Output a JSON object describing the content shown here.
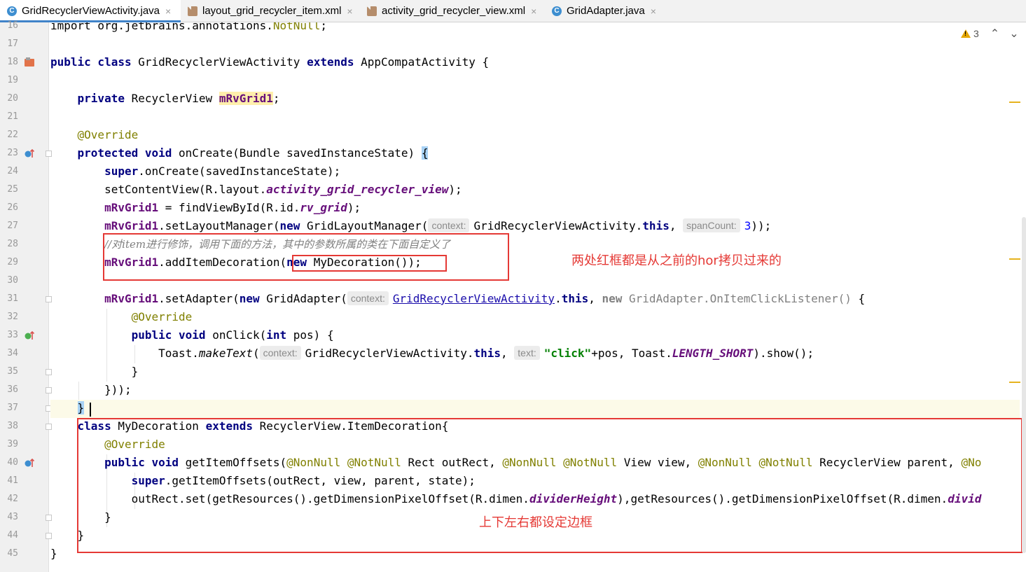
{
  "tabs": [
    {
      "label": "GridRecyclerViewActivity.java",
      "icon": "java-class-icon",
      "active": true
    },
    {
      "label": "layout_grid_recycler_item.xml",
      "icon": "xml-file-icon",
      "active": false
    },
    {
      "label": "activity_grid_recycler_view.xml",
      "icon": "xml-file-icon",
      "active": false
    },
    {
      "label": "GridAdapter.java",
      "icon": "java-class-icon",
      "active": false
    }
  ],
  "tab_close_glyph": "×",
  "java_icon_letter": "C",
  "inspections": {
    "warning_count": "3",
    "up_glyph": "⌃",
    "down_glyph": "⌄"
  },
  "line_numbers": [
    "16",
    "17",
    "18",
    "19",
    "20",
    "21",
    "22",
    "23",
    "24",
    "25",
    "26",
    "27",
    "28",
    "29",
    "30",
    "31",
    "32",
    "33",
    "34",
    "35",
    "36",
    "37",
    "38",
    "39",
    "40",
    "41",
    "42",
    "43",
    "44",
    "45"
  ],
  "lines": [
    [
      [
        "n",
        "import org.jetbrains.annotations."
      ],
      [
        "an",
        "NotNull"
      ],
      [
        "n",
        ";"
      ]
    ],
    [],
    [
      [
        "kw",
        "public class "
      ],
      [
        "n",
        "GridRecyclerViewActivity "
      ],
      [
        "kw",
        "extends "
      ],
      [
        "n",
        "AppCompatActivity {"
      ]
    ],
    [],
    [
      [
        "n",
        "    "
      ],
      [
        "kw",
        "private "
      ],
      [
        "n",
        "RecyclerView "
      ],
      [
        "fdh",
        "mRvGrid1"
      ],
      [
        "n",
        ";"
      ]
    ],
    [],
    [
      [
        "n",
        "    "
      ],
      [
        "an",
        "@Override"
      ]
    ],
    [
      [
        "n",
        "    "
      ],
      [
        "kw",
        "protected void "
      ],
      [
        "n",
        "onCreate(Bundle savedInstanceState) "
      ],
      [
        "br",
        "{"
      ]
    ],
    [
      [
        "n",
        "        "
      ],
      [
        "kw",
        "super"
      ],
      [
        "n",
        ".onCreate(savedInstanceState);"
      ]
    ],
    [
      [
        "n",
        "        setContentView(R.layout."
      ],
      [
        "st",
        "activity_grid_recycler_view"
      ],
      [
        "n",
        ");"
      ]
    ],
    [
      [
        "n",
        "        "
      ],
      [
        "fd",
        "mRvGrid1"
      ],
      [
        "n",
        " = findViewById(R.id."
      ],
      [
        "st",
        "rv_grid"
      ],
      [
        "n",
        ");"
      ]
    ],
    [
      [
        "n",
        "        "
      ],
      [
        "fd",
        "mRvGrid1"
      ],
      [
        "n",
        ".setLayoutManager("
      ],
      [
        "kw",
        "new "
      ],
      [
        "n",
        "GridLayoutManager("
      ],
      [
        "hint",
        "context:"
      ],
      [
        "n",
        "GridRecyclerViewActivity."
      ],
      [
        "kw",
        "this"
      ],
      [
        "n",
        ", "
      ],
      [
        "hint",
        "spanCount:"
      ],
      [
        "num",
        "3"
      ],
      [
        "n",
        "));"
      ]
    ],
    [
      [
        "n",
        "        "
      ],
      [
        "cm",
        "//对item进行修饰，调用下面的方法，其中的参数所属的类在下面自定义了"
      ]
    ],
    [
      [
        "n",
        "        "
      ],
      [
        "fd",
        "mRvGrid1"
      ],
      [
        "n",
        ".addItemDecoration("
      ],
      [
        "kw",
        "new "
      ],
      [
        "n",
        "MyDecoration());"
      ]
    ],
    [],
    [
      [
        "n",
        "        "
      ],
      [
        "fd",
        "mRvGrid1"
      ],
      [
        "n",
        ".setAdapter("
      ],
      [
        "kw",
        "new "
      ],
      [
        "n",
        "GridAdapter("
      ],
      [
        "hint",
        "context:"
      ],
      [
        "lnk",
        "GridRecyclerViewActivity"
      ],
      [
        "n",
        "."
      ],
      [
        "kw",
        "this"
      ],
      [
        "n",
        ", "
      ],
      [
        "kwg",
        "new "
      ],
      [
        "gr",
        "GridAdapter.OnItemClickListener() "
      ],
      [
        "n",
        "{"
      ]
    ],
    [
      [
        "n",
        "            "
      ],
      [
        "an",
        "@Override"
      ]
    ],
    [
      [
        "n",
        "            "
      ],
      [
        "kw",
        "public void "
      ],
      [
        "n",
        "onClick("
      ],
      [
        "kw",
        "int "
      ],
      [
        "n",
        "pos) {"
      ]
    ],
    [
      [
        "n",
        "                Toast."
      ],
      [
        "it",
        "makeText"
      ],
      [
        "n",
        "("
      ],
      [
        "hint",
        "context:"
      ],
      [
        "n",
        "GridRecyclerViewActivity."
      ],
      [
        "kw",
        "this"
      ],
      [
        "n",
        ", "
      ],
      [
        "hint",
        "text:"
      ],
      [
        "str",
        "\"click\""
      ],
      [
        "n",
        "+pos, Toast."
      ],
      [
        "st",
        "LENGTH_SHORT"
      ],
      [
        "n",
        ").show();"
      ]
    ],
    [
      [
        "n",
        "            }"
      ]
    ],
    [
      [
        "n",
        "        }));"
      ]
    ],
    [
      [
        "n",
        "    "
      ],
      [
        "br",
        "}"
      ]
    ],
    [
      [
        "n",
        "    "
      ],
      [
        "kw",
        "class "
      ],
      [
        "n",
        "MyDecoration "
      ],
      [
        "kw",
        "extends "
      ],
      [
        "n",
        "RecyclerView.ItemDecoration{"
      ]
    ],
    [
      [
        "n",
        "        "
      ],
      [
        "an",
        "@Override"
      ]
    ],
    [
      [
        "n",
        "        "
      ],
      [
        "kw",
        "public void "
      ],
      [
        "n",
        "getItemOffsets("
      ],
      [
        "an",
        "@NonNull @NotNull "
      ],
      [
        "n",
        "Rect outRect, "
      ],
      [
        "an",
        "@NonNull @NotNull "
      ],
      [
        "n",
        "View view, "
      ],
      [
        "an",
        "@NonNull @NotNull "
      ],
      [
        "n",
        "RecyclerView parent, "
      ],
      [
        "an",
        "@No"
      ]
    ],
    [
      [
        "n",
        "            "
      ],
      [
        "kw",
        "super"
      ],
      [
        "n",
        ".getItemOffsets(outRect, view, parent, state);"
      ]
    ],
    [
      [
        "n",
        "            outRect.set(getResources().getDimensionPixelOffset(R.dimen."
      ],
      [
        "st",
        "dividerHeight"
      ],
      [
        "n",
        "),getResources().getDimensionPixelOffset(R.dimen."
      ],
      [
        "st",
        "divid"
      ]
    ],
    [
      [
        "n",
        "        }"
      ]
    ],
    [
      [
        "n",
        "    }"
      ]
    ],
    [
      [
        "n",
        "}"
      ]
    ]
  ],
  "annotations": {
    "note1": "两处红框都是从之前的hor拷贝过来的",
    "note2": "上下左右都设定边框"
  },
  "colors": {
    "keyword": "#000080",
    "annotation": "#808000",
    "field": "#660e7a",
    "red_box": "#e53935",
    "tab_accent": "#4083c9"
  }
}
